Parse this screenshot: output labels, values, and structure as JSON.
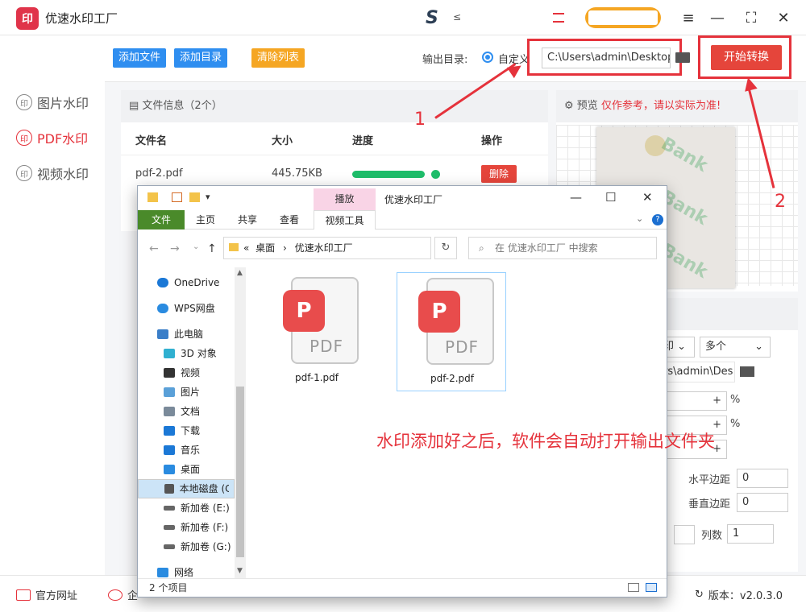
{
  "app": {
    "logo_text": "印",
    "title": "优速水印工厂",
    "brand_mark": "S",
    "brand_sub": "≤"
  },
  "window": {
    "menu_icon": "≡",
    "minimize": "—",
    "maximize": "⛶",
    "close": "✕"
  },
  "nav": [
    {
      "icon": "印",
      "label": "图片水印"
    },
    {
      "icon": "印",
      "label": "PDF水印",
      "active": true
    },
    {
      "icon": "印",
      "label": "视频水印"
    }
  ],
  "toolbar": {
    "add_file": "添加文件",
    "add_dir": "添加目录",
    "clear": "清除列表",
    "output_label": "输出目录:",
    "custom_label": "自定义",
    "path": "C:\\Users\\admin\\Desktop",
    "start": "开始转换"
  },
  "file_panel": {
    "header": "文件信息（2个）",
    "columns": [
      "文件名",
      "大小",
      "进度",
      "操作"
    ],
    "row": {
      "name": "pdf-2.pdf",
      "size": "445.75KB",
      "progress_pct": 100,
      "action": "删除"
    }
  },
  "preview": {
    "label": "预览",
    "warning": "仅作参考，请以实际为准!",
    "watermark": "Bank"
  },
  "settings": {
    "sel1": "印 ⌄",
    "sel2": "多个",
    "sel2_arrow": "⌄",
    "path": "rs\\admin\\Des",
    "pct": "%",
    "plus": "+",
    "h_margin_label": "水平边距",
    "h_margin": "0",
    "v_margin_label": "垂直边距",
    "v_margin": "0",
    "cols_label": "列数",
    "cols": "1"
  },
  "footer": {
    "site": "官方网址",
    "qi": "企",
    "version_label": "版本：v2.0.3.0"
  },
  "annotations": {
    "n1": "1",
    "n2": "2"
  },
  "explorer": {
    "ctx_tab": "播放",
    "title": "优速水印工厂",
    "tabs": [
      "文件",
      "主页",
      "共享",
      "查看",
      "视频工具"
    ],
    "help": "?",
    "path_prefix": "«",
    "path": [
      "桌面",
      "优速水印工厂"
    ],
    "refresh": "↻",
    "search_placeholder": "在 优速水印工厂 中搜索",
    "tree": [
      {
        "label": "OneDrive",
        "color": "#1b78d6"
      },
      {
        "label": "WPS网盘",
        "color": "#2a8be0"
      },
      {
        "label": "此电脑",
        "color": "#3a7ec8"
      },
      {
        "label": "3D 对象",
        "color": "#30b0d0"
      },
      {
        "label": "视频",
        "color": "#333333"
      },
      {
        "label": "图片",
        "color": "#5aa0d8"
      },
      {
        "label": "文档",
        "color": "#7a8a9a"
      },
      {
        "label": "下载",
        "color": "#1b78d6"
      },
      {
        "label": "音乐",
        "color": "#1b78d6"
      },
      {
        "label": "桌面",
        "color": "#2a8be0"
      },
      {
        "label": "本地磁盘 (C:)",
        "color": "#555555"
      },
      {
        "label": "新加卷 (E:)",
        "color": "#666666"
      },
      {
        "label": "新加卷 (F:)",
        "color": "#666666"
      },
      {
        "label": "新加卷 (G:)",
        "color": "#666666"
      },
      {
        "label": "网络",
        "color": "#2a8be0"
      }
    ],
    "files": [
      {
        "name": "pdf-1.pdf",
        "badge": "P",
        "type_text": "PDF"
      },
      {
        "name": "pdf-2.pdf",
        "badge": "P",
        "type_text": "PDF"
      }
    ],
    "message": "水印添加好之后，软件会自动打开输出文件夹",
    "status": "2 个项目"
  }
}
